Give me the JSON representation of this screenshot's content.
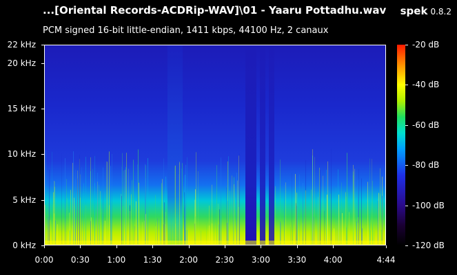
{
  "header": {
    "file_title": "...[Oriental Records-ACDRip-WAV]\\01 - Yaaru Pottadhu.wav",
    "app_name": "spek",
    "app_version": "0.8.2",
    "stream_info": "PCM signed 16-bit little-endian, 1411 kbps, 44100 Hz, 2 canaux"
  },
  "axes": {
    "frequency_labels": [
      "22 kHz",
      "20 kHz",
      "15 kHz",
      "10 kHz",
      "5 kHz",
      "0 kHz"
    ],
    "frequency_values_khz": [
      22,
      20,
      15,
      10,
      5,
      0
    ],
    "time_labels": [
      "0:00",
      "0:30",
      "1:00",
      "1:30",
      "2:00",
      "2:30",
      "3:00",
      "3:30",
      "4:00",
      "4:44"
    ],
    "time_values_s": [
      0,
      30,
      60,
      90,
      120,
      150,
      180,
      210,
      240,
      284
    ],
    "duration_s": 284,
    "max_khz": 22
  },
  "colorbar": {
    "labels": [
      "-20 dB",
      "-40 dB",
      "-60 dB",
      "-80 dB",
      "-100 dB",
      "-120 dB"
    ],
    "values_db": [
      -20,
      -40,
      -60,
      -80,
      -100,
      -120
    ],
    "min_db": -120,
    "max_db": -20
  },
  "colors": {
    "background": "#000000",
    "spectrogram_base": "#1a23c8"
  }
}
